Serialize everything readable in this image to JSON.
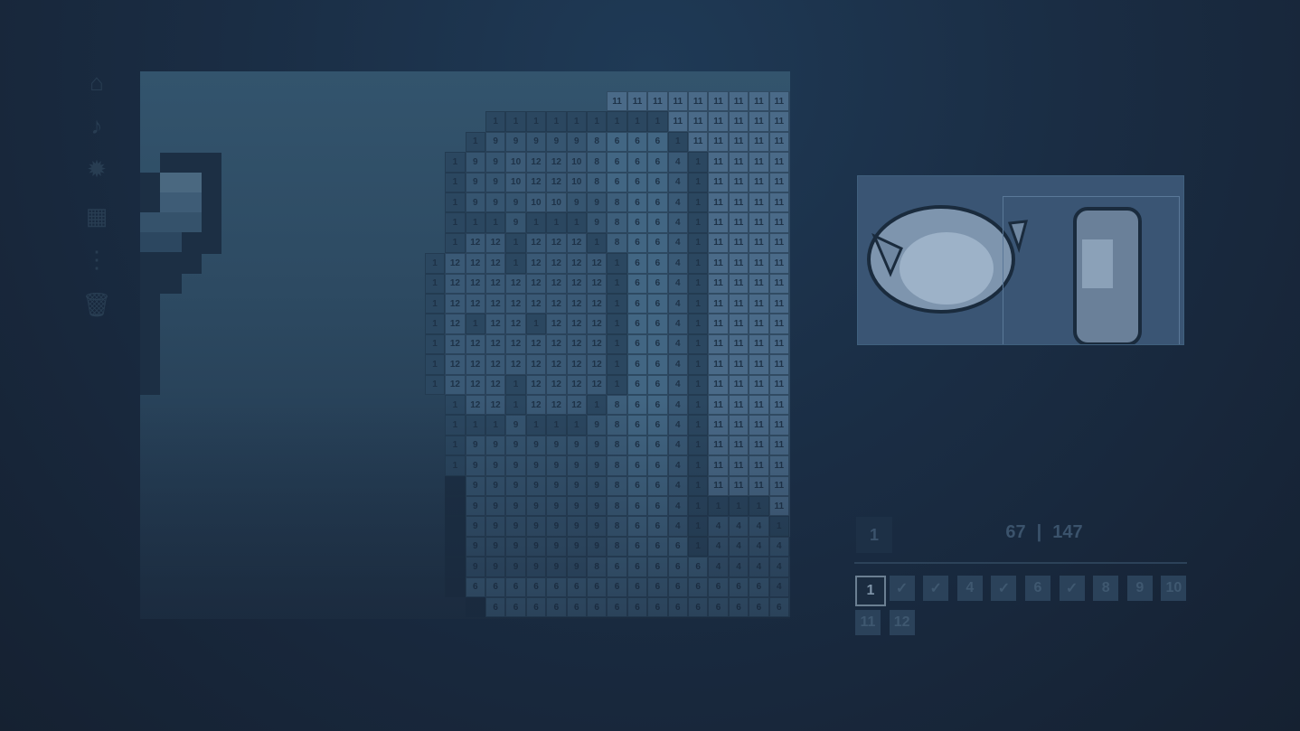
{
  "toolbar": {
    "icons": [
      "home-icon",
      "music-icon",
      "gear-icon",
      "palette-grid-icon",
      "list-icon",
      "trash-icon"
    ],
    "glyphs": [
      "⌂",
      "♪",
      "✹",
      "▦",
      "⋮",
      "🗑"
    ]
  },
  "status": {
    "current_color": "1",
    "filled": "67",
    "separator": "|",
    "total": "147"
  },
  "palette": [
    {
      "label": "1",
      "selected": true,
      "done": false
    },
    {
      "label": "✓",
      "selected": false,
      "done": true
    },
    {
      "label": "✓",
      "selected": false,
      "done": true
    },
    {
      "label": "4",
      "selected": false,
      "done": false
    },
    {
      "label": "✓",
      "selected": false,
      "done": true
    },
    {
      "label": "6",
      "selected": false,
      "done": false
    },
    {
      "label": "✓",
      "selected": false,
      "done": true
    },
    {
      "label": "8",
      "selected": false,
      "done": false
    },
    {
      "label": "9",
      "selected": false,
      "done": false
    },
    {
      "label": "10",
      "selected": false,
      "done": false
    },
    {
      "label": "11",
      "selected": false,
      "done": false
    },
    {
      "label": "12",
      "selected": false,
      "done": false
    }
  ],
  "grid_rows": [
    "...........11 11 11 11 11 11 11 11 11 11 11",
    ".....1 1 1 1 1 1 1 1 1 11 11 11 11 11 11 11",
    "....1 9 9 9 9 9 8 6 6 6 1 11 11 11 11 11 11 11",
    "...1 9 9 10 12 12 10 8 6 6 6 4 1 11 11 11 11 11 11",
    "...1 9 9 10 12 12 10 8 6 6 6 4 1 11 11 11 11 11 11",
    "...1 9 9 9 10 10 9 9 8 6 6 4 1 11 11 11 11 11 11",
    "...1 1 1 9 1 1 1 9 8 6 6 4 1 11 11 11 11 11 11",
    "...1 12 12 1 12 12 12 1 8 6 6 4 1 11 11 11 11 11 11",
    "..1 12 12 12 1 12 12 12 12 1 6 6 4 1 11 11 11 11 11 11",
    "..1 12 12 12 12 12 12 12 12 1 6 6 4 1 11 11 11 11 11 11",
    "..1 12 12 12 12 12 12 12 12 1 6 6 4 1 11 11 11 11 11 11",
    "..1 12 1 12 12 1 12 12 12 1 6 6 4 1 11 11 11 11 11 11",
    "..1 12 12 12 12 12 12 12 12 1 6 6 4 1 11 11 11 11 11 11",
    "..1 12 12 12 12 12 12 12 12 1 6 6 4 1 11 11 11 11 11 11",
    "..1 12 12 12 1 12 12 12 12 1 6 6 4 1 11 11 11 11 11 11",
    "...1 12 12 1 12 12 12 1 8 6 6 4 1 11 11 11 11 11 11",
    "...1 1 1 9 1 1 1 9 8 6 6 4 1 11 11 11 11 11 11",
    "...1 9 9 9 9 9 9 9 8 6 6 4 1 11 11 11 11 11 11",
    "...1 9 9 9 9 9 9 9 8 6 6 4 1 11 11 11 11 11 11",
    "...# 9 9 9 9 9 9 9 8 6 6 4 1 11 11 11 11 11 11",
    "...# 9 9 9 9 9 9 9 8 6 6 4 1 1 1 1 11 11 11",
    "...# 9 9 9 9 9 9 9 8 6 6 4 1 4 4 4 1 11 11",
    "...# 9 9 9 9 9 9 9 8 6 6 6 1 4 4 4 4 1 11",
    "...# 9 9 9 9 9 9 8 6 6 6 6 6 4 4 4 4 4 1",
    "...# 6 6 6 6 6 6 6 6 6 6 6 6 6 6 6 4 6 1",
    "....# 6 6 6 6 6 6 6 6 6 6 6 6 6 6 6 6 1"
  ]
}
